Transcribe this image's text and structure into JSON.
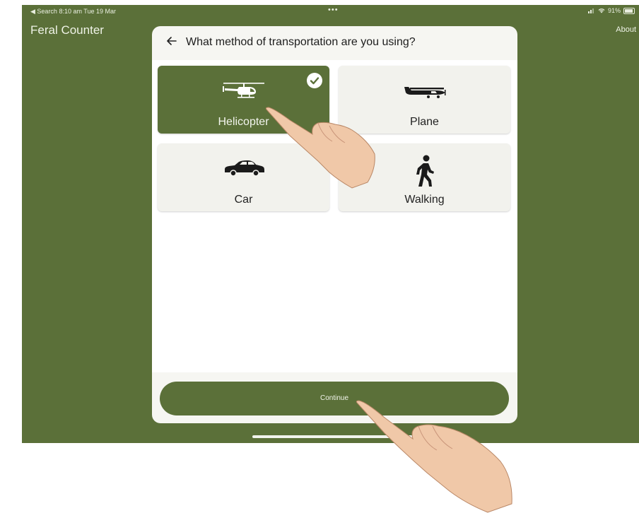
{
  "status_bar": {
    "left": "◀ Search  8:10 am  Tue 19 Mar",
    "dots": "•••",
    "battery": "91%"
  },
  "app": {
    "title": "Feral Counter",
    "about": "About"
  },
  "modal": {
    "back_icon": "arrow-left-icon",
    "question": "What method of transportation are you using?",
    "options": [
      {
        "label": "Helicopter",
        "icon": "helicopter-icon",
        "selected": true
      },
      {
        "label": "Plane",
        "icon": "plane-icon",
        "selected": false
      },
      {
        "label": "Car",
        "icon": "car-icon",
        "selected": false
      },
      {
        "label": "Walking",
        "icon": "walking-icon",
        "selected": false
      }
    ],
    "continue_label": "Continue"
  },
  "colors": {
    "brand_green": "#5b7039",
    "modal_bg": "#f6f6f2",
    "card_bg": "#f2f2ed"
  }
}
